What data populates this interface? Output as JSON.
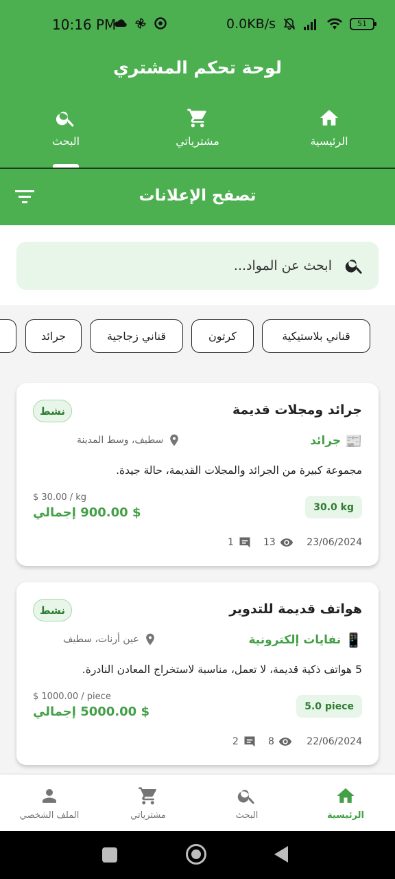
{
  "status_bar": {
    "time": "10:16 PM",
    "net_speed": "0.0KB/s",
    "battery": "51",
    "icons": [
      "cloud-icon",
      "pinwheel-icon",
      "whatsapp-icon",
      "mute-icon",
      "signal-icon",
      "wifi-icon",
      "battery-icon"
    ]
  },
  "header": {
    "title": "لوحة تحكم المشتري",
    "tabs": [
      {
        "label": "الرئيسية",
        "icon": "home-icon"
      },
      {
        "label": "مشترياتي",
        "icon": "cart-icon"
      },
      {
        "label": "البحث",
        "icon": "search-icon",
        "selected": true
      }
    ]
  },
  "section": {
    "title": "تصفح الإعلانات",
    "filter_icon": "filter-icon"
  },
  "search": {
    "placeholder": "ابحث عن المواد..."
  },
  "chips": [
    "قناني بلاستيكية",
    "كرتون",
    "قناني زجاجية",
    "جرائد"
  ],
  "cards": [
    {
      "title": "جرائد ومجلات قديمة",
      "status": "نشط",
      "category_icon": "📰",
      "category": "جرائد",
      "location": "سطيف، وسط المدينة",
      "description": "مجموعة كبيرة من الجرائد والمجلات القديمة، حالة جيدة.",
      "unit_price": "$ 30.00 / kg",
      "total": "$ 900.00 إجمالي",
      "quantity": "30.0 kg",
      "date": "23/06/2024",
      "views": "13",
      "comments": "1"
    },
    {
      "title": "هواتف قديمة للتدوير",
      "status": "نشط",
      "category_icon": "📱",
      "category": "نفايات إلكترونية",
      "location": "عين أرنات، سطيف",
      "description": "5 هواتف ذكية قديمة، لا تعمل، مناسبة لاستخراج المعادن النادرة.",
      "unit_price": "$ 1000.00 / piece",
      "total": "$ 5000.00 إجمالي",
      "quantity": "5.0 piece",
      "date": "22/06/2024",
      "views": "8",
      "comments": "2"
    }
  ],
  "bottom_nav": [
    {
      "label": "الرئيسية",
      "icon": "home-icon",
      "active": true
    },
    {
      "label": "البحث",
      "icon": "search-icon"
    },
    {
      "label": "مشترياتي",
      "icon": "cart-icon"
    },
    {
      "label": "الملف الشخصي",
      "icon": "person-icon"
    }
  ],
  "colors": {
    "primary": "#4caf50",
    "accent_text": "#43a047",
    "badge_bg": "#e8f5e9",
    "system_nav": "#000000"
  }
}
